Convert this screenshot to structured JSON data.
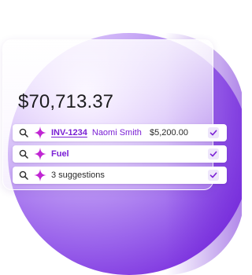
{
  "total_amount": "$70,713.37",
  "rows": [
    {
      "type": "invoice",
      "invoice_id": "INV-1234",
      "customer": "Naomi Smith",
      "amount": "$5,200.00",
      "icons": [
        "search-icon",
        "sparkle-icon",
        "check-icon"
      ]
    },
    {
      "type": "category",
      "label": "Fuel",
      "icons": [
        "search-icon",
        "sparkle-icon",
        "check-icon"
      ]
    },
    {
      "type": "suggestions",
      "label": "3 suggestions",
      "icons": [
        "search-icon",
        "sparkle-icon",
        "check-icon"
      ]
    }
  ],
  "colors": {
    "accent": "#7a1fd4",
    "sparkle": "#c026d3",
    "sphere_dark": "#6f1fd8",
    "sphere_light": "#f7f1ff",
    "check_bg": "#eee6fb",
    "text": "#1d1d1f"
  }
}
